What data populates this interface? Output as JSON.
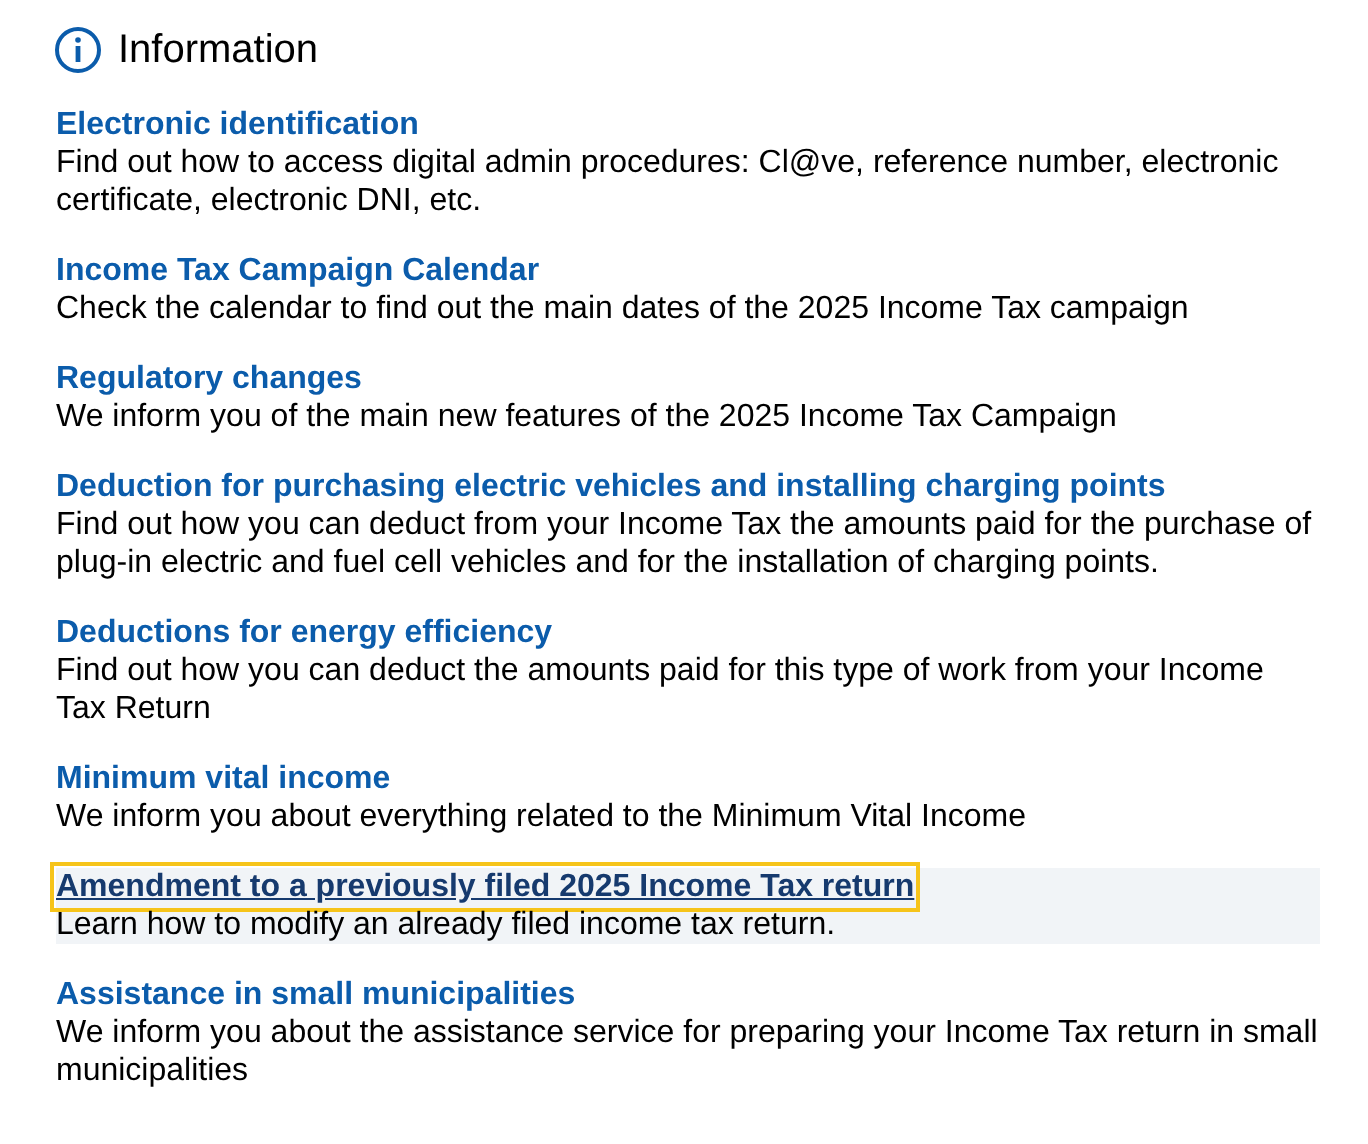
{
  "title": "Information",
  "items": [
    {
      "link": "Electronic identification",
      "description": "Find out how to access digital admin procedures: Cl@ve, reference number, electronic certificate, electronic DNI, etc.",
      "focused": false
    },
    {
      "link": "Income Tax Campaign Calendar",
      "description": "Check the calendar to find out the main dates of the 2025 Income Tax campaign",
      "focused": false
    },
    {
      "link": "Regulatory changes",
      "description": "We inform you of the main new features of the 2025 Income Tax Campaign",
      "focused": false
    },
    {
      "link": "Deduction for purchasing electric vehicles and installing charging points",
      "description": "Find out how you can deduct from your Income Tax the amounts paid for the purchase of plug-in electric and fuel cell vehicles and for the installation of charging points.",
      "focused": false
    },
    {
      "link": "Deductions for energy efficiency",
      "description": "Find out how you can deduct the amounts paid for this type of work from your Income Tax Return",
      "focused": false
    },
    {
      "link": "Minimum vital income",
      "description": "We inform you about everything related to the Minimum Vital Income",
      "focused": false
    },
    {
      "link": "Amendment to a previously filed 2025 Income Tax return",
      "description": "Learn how to modify an already filed income tax return.",
      "focused": true
    },
    {
      "link": "Assistance in small municipalities",
      "description": "We inform you about the assistance service for preparing your Income Tax return in small municipalities",
      "focused": false
    }
  ]
}
